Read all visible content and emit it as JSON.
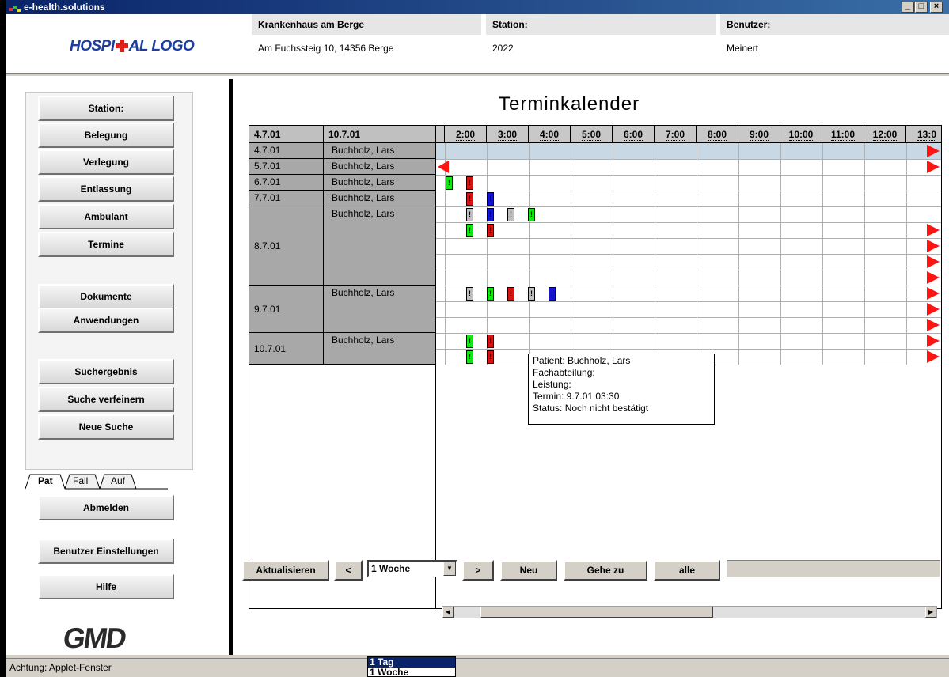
{
  "window": {
    "title": "e-health.solutions",
    "min_label": "_",
    "max_label": "□",
    "close_label": "×"
  },
  "header": {
    "logo_text_a": "HOSPI",
    "logo_text_b": "AL LOGO",
    "hospital_name": "Krankenhaus am Berge",
    "hospital_address": "Am Fuchssteig 10, 14356 Berge",
    "station_label": "Station:",
    "station_value": "2022",
    "user_label": "Benutzer:",
    "user_value": "Meinert"
  },
  "sidebar": {
    "buttons": [
      "Station:",
      "Belegung",
      "Verlegung",
      "Entlassung",
      "Ambulant",
      "Termine",
      "Dokumente",
      "Anwendungen",
      "Suchergebnis",
      "Suche verfeinern",
      "Neue Suche"
    ],
    "tabs": [
      "Pat",
      "Fall",
      "Auf"
    ],
    "bottom_buttons": [
      "Abmelden",
      "Benutzer Einstellungen",
      "Hilfe"
    ],
    "vendor_logo": "GMD"
  },
  "calendar": {
    "title": "Terminkalender",
    "col_date": "4.7.01",
    "col_name": "10.7.01",
    "times": [
      "2:00",
      "3:00",
      "4:00",
      "5:00",
      "6:00",
      "7:00",
      "8:00",
      "9:00",
      "10:00",
      "11:00",
      "12:00",
      "13:0"
    ],
    "rows": [
      {
        "date": "4.7.01",
        "name": "Buchholz, Lars"
      },
      {
        "date": "5.7.01",
        "name": "Buchholz, Lars"
      },
      {
        "date": "6.7.01",
        "name": "Buchholz, Lars"
      },
      {
        "date": "7.7.01",
        "name": "Buchholz, Lars"
      },
      {
        "date": "8.7.01",
        "name": "Buchholz, Lars"
      },
      {
        "date": "9.7.01",
        "name": "Buchholz, Lars"
      },
      {
        "date": "10.7.01",
        "name": "Buchholz, Lars"
      }
    ],
    "marker_symbol": "!",
    "colors": {
      "green": "#14e614",
      "red": "#d21414",
      "blue": "#1414d2",
      "gray": "#c0c0c0",
      "arrow": "#ff1414",
      "highlight_row": "#c8d8e4"
    },
    "tooltip": {
      "patient": "Patient: Buchholz, Lars",
      "department": "Fachabteilung:",
      "service": "Leistung:",
      "appointment": "Termin: 9.7.01 03:30",
      "status": "Status: Noch nicht bestätigt"
    }
  },
  "toolbar": {
    "refresh": "Aktualisieren",
    "prev": "<",
    "range_value": "1 Woche",
    "next": ">",
    "new": "Neu",
    "goto": "Gehe zu",
    "all": "alle",
    "dropdown_options": [
      "1 Tag",
      "1 Woche"
    ]
  },
  "statusbar": {
    "text": "Achtung: Applet-Fenster"
  }
}
